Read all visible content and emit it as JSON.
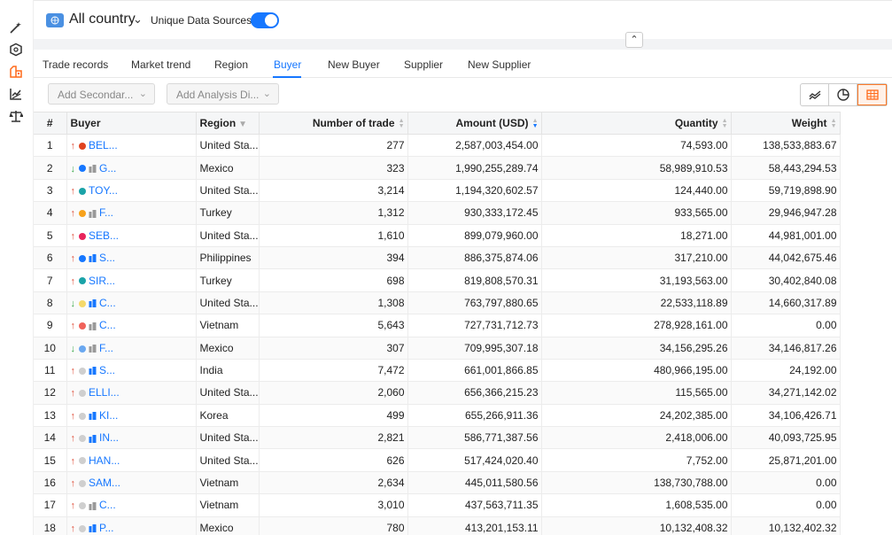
{
  "header": {
    "country": "All country",
    "unique_label": "Unique Data Sources",
    "toggle_on": true
  },
  "tabs": [
    "Trade records",
    "Market trend",
    "Region",
    "Buyer",
    "New Buyer",
    "Supplier",
    "New Supplier"
  ],
  "active_tab": "Buyer",
  "selects": {
    "secondary": "Add Secondar...",
    "analysis": "Add Analysis Di..."
  },
  "table": {
    "columns": [
      "#",
      "Buyer",
      "Region",
      "Number of trade",
      "Amount (USD)",
      "Quantity",
      "Weight"
    ],
    "rows": [
      {
        "n": "1",
        "trend": "up",
        "dot": "#e0431f",
        "bld": "",
        "name": "BEL...",
        "region": "United Sta...",
        "trades": "277",
        "amount": "2,587,003,454.00",
        "qty": "74,593.00",
        "weight": "138,533,883.67"
      },
      {
        "n": "2",
        "trend": "down",
        "dot": "#1677ff",
        "bld": "grey",
        "name": "G...",
        "region": "Mexico",
        "trades": "323",
        "amount": "1,990,255,289.74",
        "qty": "58,989,910.53",
        "weight": "58,443,294.53"
      },
      {
        "n": "3",
        "trend": "up",
        "dot": "#1aa3a8",
        "bld": "",
        "name": "TOY...",
        "region": "United Sta...",
        "trades": "3,214",
        "amount": "1,194,320,602.57",
        "qty": "124,440.00",
        "weight": "59,719,898.90"
      },
      {
        "n": "4",
        "trend": "up",
        "dot": "#f7a21b",
        "bld": "grey",
        "name": "F...",
        "region": "Turkey",
        "trades": "1,312",
        "amount": "930,333,172.45",
        "qty": "933,565.00",
        "weight": "29,946,947.28"
      },
      {
        "n": "5",
        "trend": "up",
        "dot": "#e8245b",
        "bld": "",
        "name": "SEB...",
        "region": "United Sta...",
        "trades": "1,610",
        "amount": "899,079,960.00",
        "qty": "18,271.00",
        "weight": "44,981,001.00"
      },
      {
        "n": "6",
        "trend": "up",
        "dot": "#1677ff",
        "bld": "blue",
        "name": "S...",
        "region": "Philippines",
        "trades": "394",
        "amount": "886,375,874.06",
        "qty": "317,210.00",
        "weight": "44,042,675.46"
      },
      {
        "n": "7",
        "trend": "up",
        "dot": "#1aa3a8",
        "bld": "",
        "name": "SIR...",
        "region": "Turkey",
        "trades": "698",
        "amount": "819,808,570.31",
        "qty": "31,193,563.00",
        "weight": "30,402,840.08"
      },
      {
        "n": "8",
        "trend": "down",
        "dot": "#f5d96a",
        "bld": "blue",
        "name": "C...",
        "region": "United Sta...",
        "trades": "1,308",
        "amount": "763,797,880.65",
        "qty": "22,533,118.89",
        "weight": "14,660,317.89"
      },
      {
        "n": "9",
        "trend": "up",
        "dot": "#f0625a",
        "bld": "grey",
        "name": "C...",
        "region": "Vietnam",
        "trades": "5,643",
        "amount": "727,731,712.73",
        "qty": "278,928,161.00",
        "weight": "0.00"
      },
      {
        "n": "10",
        "trend": "down",
        "dot": "#6aa8f0",
        "bld": "grey",
        "name": "F...",
        "region": "Mexico",
        "trades": "307",
        "amount": "709,995,307.18",
        "qty": "34,156,295.26",
        "weight": "34,146,817.26"
      },
      {
        "n": "11",
        "trend": "up",
        "dot": "#cfcfcf",
        "bld": "blue",
        "name": "S...",
        "region": "India",
        "trades": "7,472",
        "amount": "661,001,866.85",
        "qty": "480,966,195.00",
        "weight": "24,192.00"
      },
      {
        "n": "12",
        "trend": "up",
        "dot": "#cfcfcf",
        "bld": "",
        "name": "ELLI...",
        "region": "United Sta...",
        "trades": "2,060",
        "amount": "656,366,215.23",
        "qty": "115,565.00",
        "weight": "34,271,142.02"
      },
      {
        "n": "13",
        "trend": "up",
        "dot": "#cfcfcf",
        "bld": "blue",
        "name": "KI...",
        "region": "Korea",
        "trades": "499",
        "amount": "655,266,911.36",
        "qty": "24,202,385.00",
        "weight": "34,106,426.71"
      },
      {
        "n": "14",
        "trend": "up",
        "dot": "#cfcfcf",
        "bld": "blue",
        "name": "IN...",
        "region": "United Sta...",
        "trades": "2,821",
        "amount": "586,771,387.56",
        "qty": "2,418,006.00",
        "weight": "40,093,725.95"
      },
      {
        "n": "15",
        "trend": "up",
        "dot": "#cfcfcf",
        "bld": "",
        "name": "HAN...",
        "region": "United Sta...",
        "trades": "626",
        "amount": "517,424,020.40",
        "qty": "7,752.00",
        "weight": "25,871,201.00"
      },
      {
        "n": "16",
        "trend": "up",
        "dot": "#cfcfcf",
        "bld": "",
        "name": "SAM...",
        "region": "Vietnam",
        "trades": "2,634",
        "amount": "445,011,580.56",
        "qty": "138,730,788.00",
        "weight": "0.00"
      },
      {
        "n": "17",
        "trend": "up",
        "dot": "#cfcfcf",
        "bld": "grey",
        "name": "C...",
        "region": "Vietnam",
        "trades": "3,010",
        "amount": "437,563,711.35",
        "qty": "1,608,535.00",
        "weight": "0.00"
      },
      {
        "n": "18",
        "trend": "up",
        "dot": "#cfcfcf",
        "bld": "blue",
        "name": "P...",
        "region": "Mexico",
        "trades": "780",
        "amount": "413,201,153.11",
        "qty": "10,132,408.32",
        "weight": "10,132,402.32"
      }
    ]
  },
  "icons": {
    "rail": [
      "magic-wand-icon",
      "cube-icon",
      "factory-icon",
      "line-chart-icon",
      "scale-icon"
    ],
    "view": [
      "line-chart-icon",
      "pie-chart-icon",
      "table-grid-icon"
    ]
  }
}
